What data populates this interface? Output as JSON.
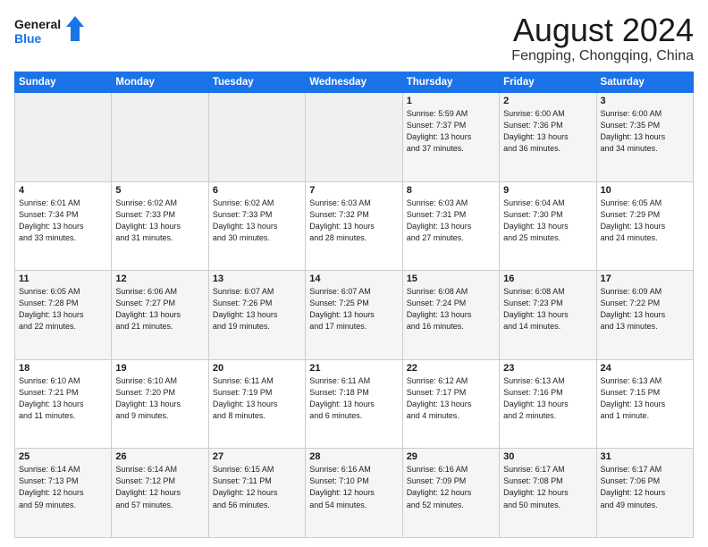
{
  "header": {
    "logo_line1": "General",
    "logo_line2": "Blue",
    "month": "August 2024",
    "location": "Fengping, Chongqing, China"
  },
  "weekdays": [
    "Sunday",
    "Monday",
    "Tuesday",
    "Wednesday",
    "Thursday",
    "Friday",
    "Saturday"
  ],
  "weeks": [
    [
      {
        "day": "",
        "info": ""
      },
      {
        "day": "",
        "info": ""
      },
      {
        "day": "",
        "info": ""
      },
      {
        "day": "",
        "info": ""
      },
      {
        "day": "1",
        "info": "Sunrise: 5:59 AM\nSunset: 7:37 PM\nDaylight: 13 hours\nand 37 minutes."
      },
      {
        "day": "2",
        "info": "Sunrise: 6:00 AM\nSunset: 7:36 PM\nDaylight: 13 hours\nand 36 minutes."
      },
      {
        "day": "3",
        "info": "Sunrise: 6:00 AM\nSunset: 7:35 PM\nDaylight: 13 hours\nand 34 minutes."
      }
    ],
    [
      {
        "day": "4",
        "info": "Sunrise: 6:01 AM\nSunset: 7:34 PM\nDaylight: 13 hours\nand 33 minutes."
      },
      {
        "day": "5",
        "info": "Sunrise: 6:02 AM\nSunset: 7:33 PM\nDaylight: 13 hours\nand 31 minutes."
      },
      {
        "day": "6",
        "info": "Sunrise: 6:02 AM\nSunset: 7:33 PM\nDaylight: 13 hours\nand 30 minutes."
      },
      {
        "day": "7",
        "info": "Sunrise: 6:03 AM\nSunset: 7:32 PM\nDaylight: 13 hours\nand 28 minutes."
      },
      {
        "day": "8",
        "info": "Sunrise: 6:03 AM\nSunset: 7:31 PM\nDaylight: 13 hours\nand 27 minutes."
      },
      {
        "day": "9",
        "info": "Sunrise: 6:04 AM\nSunset: 7:30 PM\nDaylight: 13 hours\nand 25 minutes."
      },
      {
        "day": "10",
        "info": "Sunrise: 6:05 AM\nSunset: 7:29 PM\nDaylight: 13 hours\nand 24 minutes."
      }
    ],
    [
      {
        "day": "11",
        "info": "Sunrise: 6:05 AM\nSunset: 7:28 PM\nDaylight: 13 hours\nand 22 minutes."
      },
      {
        "day": "12",
        "info": "Sunrise: 6:06 AM\nSunset: 7:27 PM\nDaylight: 13 hours\nand 21 minutes."
      },
      {
        "day": "13",
        "info": "Sunrise: 6:07 AM\nSunset: 7:26 PM\nDaylight: 13 hours\nand 19 minutes."
      },
      {
        "day": "14",
        "info": "Sunrise: 6:07 AM\nSunset: 7:25 PM\nDaylight: 13 hours\nand 17 minutes."
      },
      {
        "day": "15",
        "info": "Sunrise: 6:08 AM\nSunset: 7:24 PM\nDaylight: 13 hours\nand 16 minutes."
      },
      {
        "day": "16",
        "info": "Sunrise: 6:08 AM\nSunset: 7:23 PM\nDaylight: 13 hours\nand 14 minutes."
      },
      {
        "day": "17",
        "info": "Sunrise: 6:09 AM\nSunset: 7:22 PM\nDaylight: 13 hours\nand 13 minutes."
      }
    ],
    [
      {
        "day": "18",
        "info": "Sunrise: 6:10 AM\nSunset: 7:21 PM\nDaylight: 13 hours\nand 11 minutes."
      },
      {
        "day": "19",
        "info": "Sunrise: 6:10 AM\nSunset: 7:20 PM\nDaylight: 13 hours\nand 9 minutes."
      },
      {
        "day": "20",
        "info": "Sunrise: 6:11 AM\nSunset: 7:19 PM\nDaylight: 13 hours\nand 8 minutes."
      },
      {
        "day": "21",
        "info": "Sunrise: 6:11 AM\nSunset: 7:18 PM\nDaylight: 13 hours\nand 6 minutes."
      },
      {
        "day": "22",
        "info": "Sunrise: 6:12 AM\nSunset: 7:17 PM\nDaylight: 13 hours\nand 4 minutes."
      },
      {
        "day": "23",
        "info": "Sunrise: 6:13 AM\nSunset: 7:16 PM\nDaylight: 13 hours\nand 2 minutes."
      },
      {
        "day": "24",
        "info": "Sunrise: 6:13 AM\nSunset: 7:15 PM\nDaylight: 13 hours\nand 1 minute."
      }
    ],
    [
      {
        "day": "25",
        "info": "Sunrise: 6:14 AM\nSunset: 7:13 PM\nDaylight: 12 hours\nand 59 minutes."
      },
      {
        "day": "26",
        "info": "Sunrise: 6:14 AM\nSunset: 7:12 PM\nDaylight: 12 hours\nand 57 minutes."
      },
      {
        "day": "27",
        "info": "Sunrise: 6:15 AM\nSunset: 7:11 PM\nDaylight: 12 hours\nand 56 minutes."
      },
      {
        "day": "28",
        "info": "Sunrise: 6:16 AM\nSunset: 7:10 PM\nDaylight: 12 hours\nand 54 minutes."
      },
      {
        "day": "29",
        "info": "Sunrise: 6:16 AM\nSunset: 7:09 PM\nDaylight: 12 hours\nand 52 minutes."
      },
      {
        "day": "30",
        "info": "Sunrise: 6:17 AM\nSunset: 7:08 PM\nDaylight: 12 hours\nand 50 minutes."
      },
      {
        "day": "31",
        "info": "Sunrise: 6:17 AM\nSunset: 7:06 PM\nDaylight: 12 hours\nand 49 minutes."
      }
    ]
  ]
}
